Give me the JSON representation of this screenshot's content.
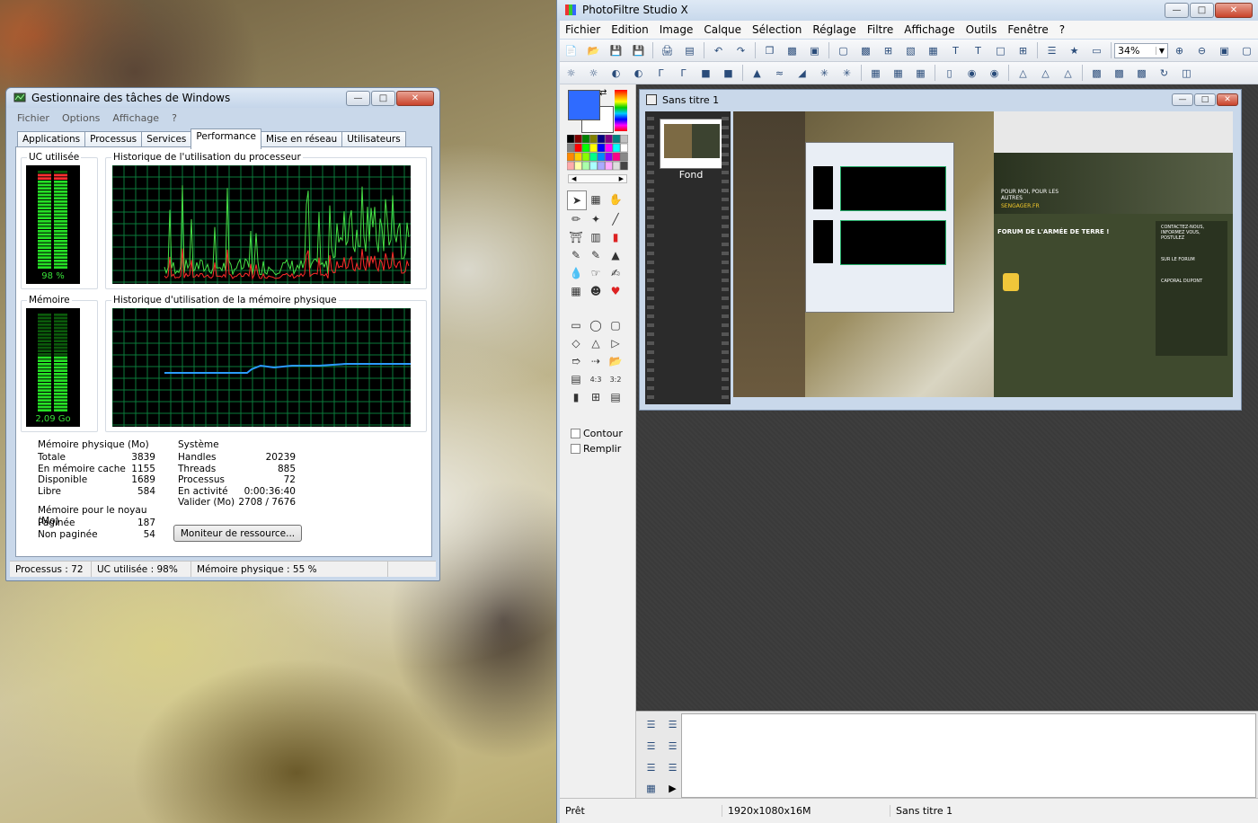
{
  "task_manager": {
    "title": "Gestionnaire des tâches de Windows",
    "menu": [
      "Fichier",
      "Options",
      "Affichage",
      "?"
    ],
    "tabs": [
      "Applications",
      "Processus",
      "Services",
      "Performance",
      "Mise en réseau",
      "Utilisateurs"
    ],
    "active_tab": "Performance",
    "cpu_group_label": "UC utilisée",
    "cpu_value": "98 %",
    "cpu_history_label": "Historique de l'utilisation du processeur",
    "mem_group_label": "Mémoire",
    "mem_value": "2,09 Go",
    "mem_history_label": "Historique d'utilisation de la mémoire physique",
    "physical_memory": {
      "label": "Mémoire physique (Mo)",
      "rows": [
        {
          "k": "Totale",
          "v": "3839"
        },
        {
          "k": "En mémoire cache",
          "v": "1155"
        },
        {
          "k": "Disponible",
          "v": "1689"
        },
        {
          "k": "Libre",
          "v": "584"
        }
      ]
    },
    "system": {
      "label": "Système",
      "rows": [
        {
          "k": "Handles",
          "v": "20239"
        },
        {
          "k": "Threads",
          "v": "885"
        },
        {
          "k": "Processus",
          "v": "72"
        },
        {
          "k": "En activité",
          "v": "0:00:36:40"
        },
        {
          "k": "Valider (Mo)",
          "v": "2708 / 7676"
        }
      ]
    },
    "kernel_memory": {
      "label": "Mémoire pour le noyau (Mo)",
      "rows": [
        {
          "k": "Paginée",
          "v": "187"
        },
        {
          "k": "Non paginée",
          "v": "54"
        }
      ]
    },
    "resource_monitor_button": "Moniteur de ressource...",
    "status": [
      "Processus : 72",
      "UC utilisée : 98%",
      "Mémoire physique : 55 %"
    ],
    "cpu_percent": 98,
    "mem_percent": 55
  },
  "photofiltre": {
    "title": "PhotoFiltre Studio X",
    "menu": [
      "Fichier",
      "Edition",
      "Image",
      "Calque",
      "Sélection",
      "Réglage",
      "Filtre",
      "Affichage",
      "Outils",
      "Fenêtre",
      "?"
    ],
    "zoom": "34%",
    "document_title": "Sans titre 1",
    "layer_name": "Fond",
    "contour_label": "Contour",
    "remplir_label": "Remplir",
    "foreground_color": "#2f6bff",
    "status": [
      "Prêt",
      "1920x1080x16M",
      "Sans titre 1"
    ],
    "thumb_texts": {
      "big_heading": "FORUM DE L'ARMÉE DE TERRE !",
      "promo": "POUR MOI, POUR LES AUTRES",
      "site": "SENGAGER.FR",
      "side1": "CONTACTEZ-NOUS, INFORMEZ VOUS, POSTULEZ",
      "side2": "SUR LE FORUM",
      "side3": "CAPORAL DUPONT"
    }
  }
}
